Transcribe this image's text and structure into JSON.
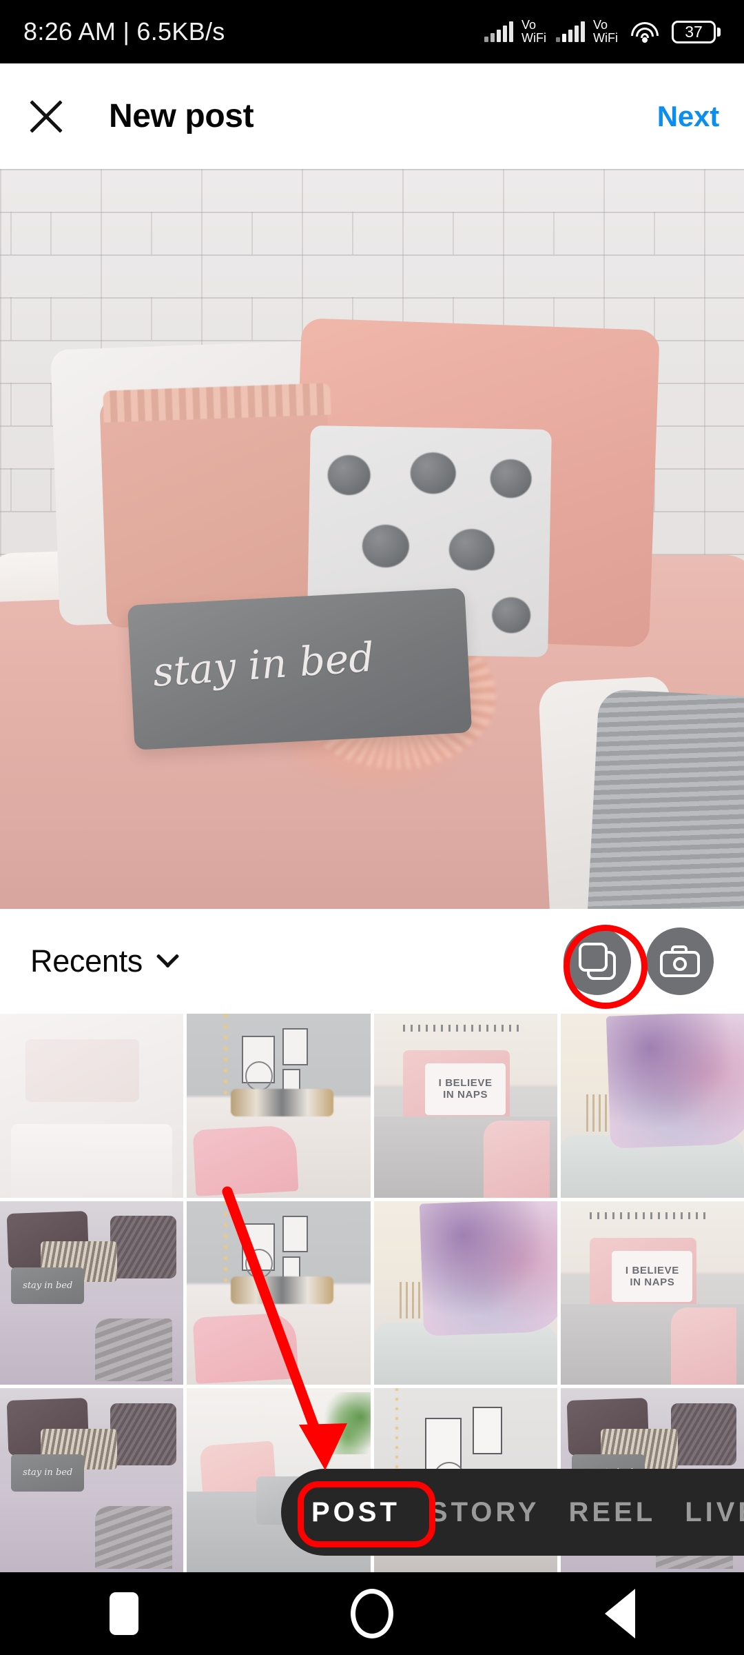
{
  "status_bar": {
    "time_and_speed": "8:26 AM | 6.5KB/s",
    "sim1_label": "Vo\nWiFi",
    "sim1_line1": "Vo",
    "sim1_line2": "WiFi",
    "sim2_line1": "Vo",
    "sim2_line2": "WiFi",
    "battery_level": "37"
  },
  "header": {
    "close_label": "",
    "title": "New post",
    "next_label": "Next",
    "next_color": "#0c8ef0"
  },
  "preview": {
    "pillow_text": "stay in bed",
    "alt": "Pink and grey bedding with decorative pillows against a white brick wall"
  },
  "album_bar": {
    "album_name": "Recents",
    "multiselect_icon": "layers-icon",
    "camera_icon": "camera-icon",
    "highlight_color": "#ff0000"
  },
  "gallery": {
    "columns": 4,
    "rows": 3,
    "items": [
      {
        "id": "thumb-1",
        "style": "t-faint",
        "caption": ""
      },
      {
        "id": "thumb-2",
        "style": "t-gray-room",
        "caption": ""
      },
      {
        "id": "thumb-3",
        "style": "t-naps",
        "caption": "I BELIEVE IN NAPS"
      },
      {
        "id": "thumb-4",
        "style": "t-purple",
        "caption": ""
      },
      {
        "id": "thumb-5",
        "style": "t-lav",
        "caption": "stay in bed"
      },
      {
        "id": "thumb-6",
        "style": "t-gray-room",
        "caption": ""
      },
      {
        "id": "thumb-7",
        "style": "t-purple",
        "caption": ""
      },
      {
        "id": "thumb-8",
        "style": "t-naps",
        "caption": "I BELIEVE IN NAPS"
      },
      {
        "id": "thumb-9",
        "style": "t-lav",
        "caption": "stay in bed"
      },
      {
        "id": "thumb-10",
        "style": "t-pinkgray",
        "caption": ""
      },
      {
        "id": "thumb-11",
        "style": "t-gallery",
        "caption": ""
      },
      {
        "id": "thumb-12",
        "style": "t-lav",
        "caption": "stay in bed"
      }
    ],
    "naps_line1": "I BELIEVE",
    "naps_line2": "IN NAPS"
  },
  "mode_tabs": {
    "selected": "POST",
    "items": [
      {
        "label": "POST",
        "active": true
      },
      {
        "label": "STORY",
        "active": false
      },
      {
        "label": "REEL",
        "active": false
      },
      {
        "label": "LIVE",
        "active": false
      }
    ]
  },
  "nav_bar": {
    "recents_icon": "square-icon",
    "home_icon": "circle-icon",
    "back_icon": "triangle-back-icon"
  },
  "annotations": {
    "arrow_1_target": "multiselect-button",
    "arrow_2_target": "post-tab",
    "color": "#ff0000"
  }
}
